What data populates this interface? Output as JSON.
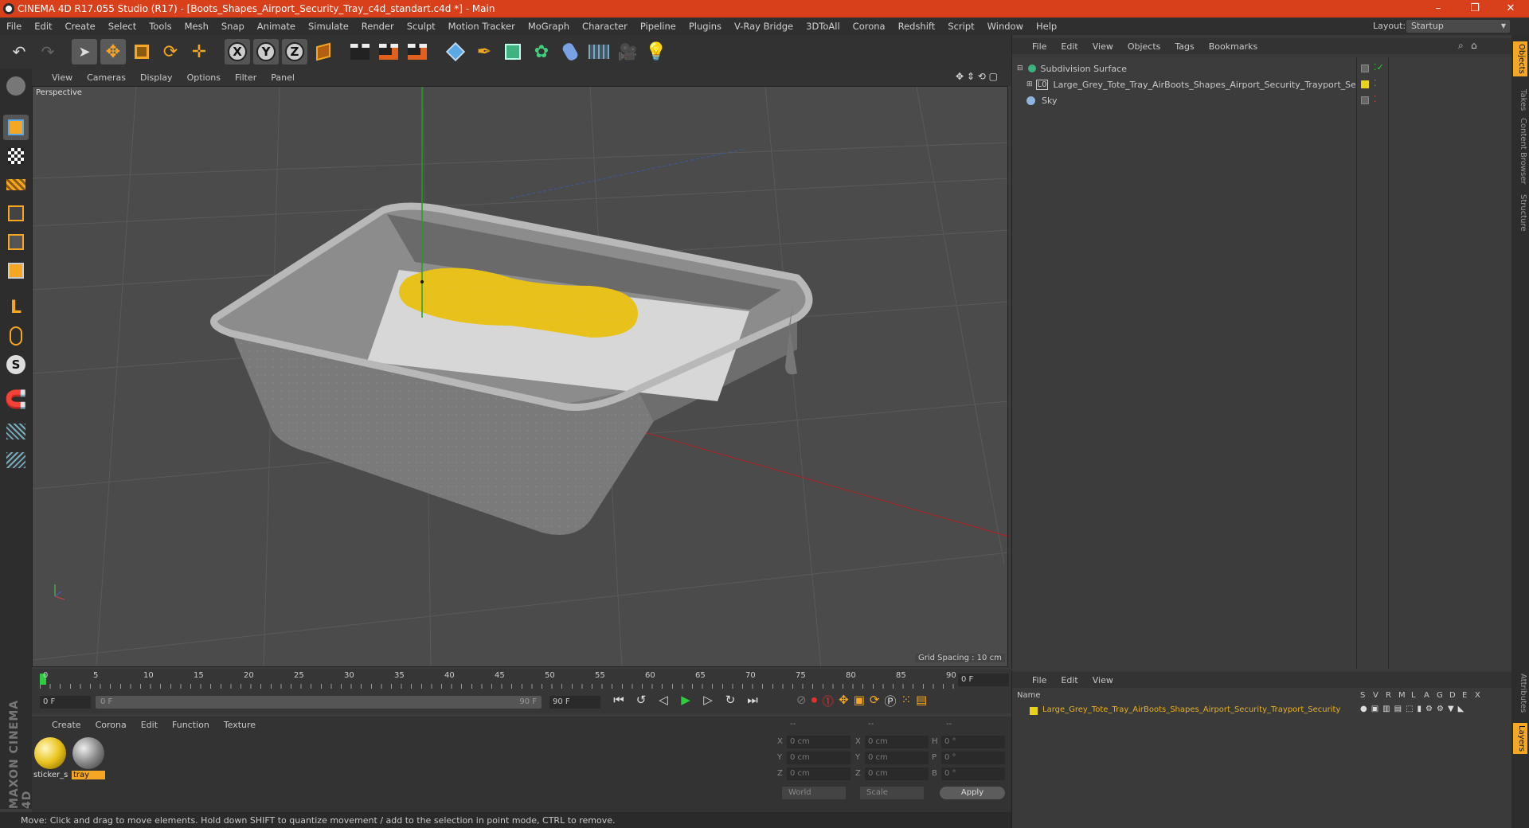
{
  "titlebar": {
    "title": "CINEMA 4D R17.055 Studio (R17) - [Boots_Shapes_Airport_Security_Tray_c4d_standart.c4d *] - Main",
    "minimize": "–",
    "restore": "❐",
    "close": "✕"
  },
  "menubar": {
    "items": [
      "File",
      "Edit",
      "Create",
      "Select",
      "Tools",
      "Mesh",
      "Snap",
      "Animate",
      "Simulate",
      "Render",
      "Sculpt",
      "Motion Tracker",
      "MoGraph",
      "Character",
      "Pipeline",
      "Plugins",
      "V-Ray Bridge",
      "3DToAll",
      "Corona",
      "Redshift",
      "Script",
      "Window",
      "Help"
    ],
    "layout_label": "Layout:",
    "layout_value": "Startup"
  },
  "viewport": {
    "menu": [
      "View",
      "Cameras",
      "Display",
      "Options",
      "Filter",
      "Panel"
    ],
    "camera_label": "Perspective",
    "grid_spacing": "Grid Spacing : 10 cm"
  },
  "timeline": {
    "ticks": [
      "0",
      "5",
      "10",
      "15",
      "20",
      "25",
      "30",
      "35",
      "40",
      "45",
      "50",
      "55",
      "60",
      "65",
      "70",
      "75",
      "80",
      "85",
      "90"
    ],
    "current_frame": "0 F",
    "start_field": "0 F",
    "range_start": "0 F",
    "range_end": "90 F",
    "end_field": "90 F"
  },
  "material_panel": {
    "menu": [
      "Create",
      "Corona",
      "Edit",
      "Function",
      "Texture"
    ],
    "materials": [
      "sticker_s",
      "tray"
    ]
  },
  "coord_panel": {
    "header": [
      "--",
      "--",
      "--"
    ],
    "rows": [
      {
        "a": "X",
        "av": "0 cm",
        "b": "X",
        "bv": "0 cm",
        "c": "H",
        "cv": "0 °"
      },
      {
        "a": "Y",
        "av": "0 cm",
        "b": "Y",
        "bv": "0 cm",
        "c": "P",
        "cv": "0 °"
      },
      {
        "a": "Z",
        "av": "0 cm",
        "b": "Z",
        "bv": "0 cm",
        "c": "B",
        "cv": "0 °"
      }
    ],
    "world": "World",
    "scale": "Scale",
    "apply": "Apply"
  },
  "statusbar": {
    "text": "Move: Click and drag to move elements. Hold down SHIFT to quantize movement / add to the selection in point mode, CTRL to remove."
  },
  "object_manager": {
    "menu": [
      "File",
      "Edit",
      "View",
      "Objects",
      "Tags",
      "Bookmarks"
    ],
    "objects": [
      {
        "name": "Subdivision Surface",
        "color": "#7fd07f"
      },
      {
        "name": "Large_Grey_Tote_Tray_AirBoots_Shapes_Airport_Security_Trayport_Security",
        "color": "#cfcfcf"
      },
      {
        "name": "Sky",
        "color": "#8fb4e0"
      }
    ]
  },
  "layer_manager": {
    "menu": [
      "File",
      "Edit",
      "View"
    ],
    "name_header": "Name",
    "cols": [
      "S",
      "V",
      "R",
      "M",
      "L",
      "A",
      "G",
      "D",
      "E",
      "X"
    ],
    "layer_name": "Large_Grey_Tote_Tray_AirBoots_Shapes_Airport_Security_Trayport_Security"
  },
  "right_tabs": [
    "Objects",
    "Takes",
    "Content Browser",
    "Structure",
    "Attributes",
    "Layers"
  ],
  "branding": "MAXON CINEMA 4D",
  "colors": {
    "accent": "#d8401c",
    "icon_orange": "#f5a623",
    "icon_blue": "#5aa9e6",
    "sticker": "#e8c21a"
  }
}
